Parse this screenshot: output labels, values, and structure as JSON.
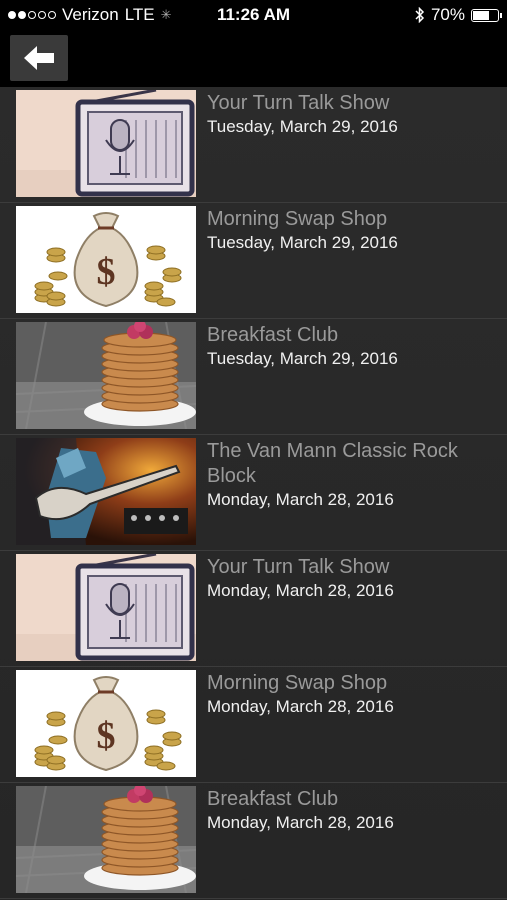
{
  "status_bar": {
    "carrier": "Verizon",
    "network": "LTE",
    "time": "11:26 AM",
    "battery_percent": "70%",
    "battery_level": 0.7,
    "signal_bars_filled": 2,
    "signal_bars_total": 5,
    "icons": [
      "signal-dots-icon",
      "loading-spinner-icon",
      "bluetooth-icon",
      "battery-icon"
    ]
  },
  "nav": {
    "back_icon": "back-arrow-icon"
  },
  "episodes": [
    {
      "title": "Your Turn Talk Show",
      "date": "Tuesday, March 29, 2016",
      "thumbnail": "radio"
    },
    {
      "title": "Morning Swap Shop",
      "date": "Tuesday, March 29, 2016",
      "thumbnail": "money-bag"
    },
    {
      "title": "Breakfast Club",
      "date": "Tuesday, March 29, 2016",
      "thumbnail": "pancakes"
    },
    {
      "title": "The Van Mann Classic Rock Block",
      "date": "Monday, March 28, 2016",
      "thumbnail": "guitarist"
    },
    {
      "title": "Your Turn Talk Show",
      "date": "Monday, March 28, 2016",
      "thumbnail": "radio"
    },
    {
      "title": "Morning Swap Shop",
      "date": "Monday, March 28, 2016",
      "thumbnail": "money-bag"
    },
    {
      "title": "Breakfast Club",
      "date": "Monday, March 28, 2016",
      "thumbnail": "pancakes"
    }
  ],
  "colors": {
    "title_text": "#9a9a9a",
    "date_text": "#f0f0f0",
    "background": "#2a2a2a",
    "bar_background": "#000000"
  }
}
